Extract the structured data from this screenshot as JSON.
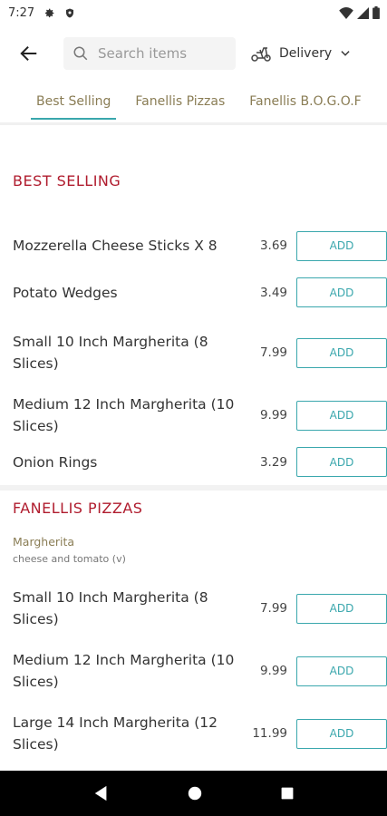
{
  "status": {
    "time": "7:27"
  },
  "search": {
    "placeholder": "Search items"
  },
  "delivery": {
    "label": "Delivery"
  },
  "tabs": [
    {
      "label": "Best Selling"
    },
    {
      "label": "Fanellis Pizzas"
    },
    {
      "label": "Fanellis B.O.G.O.F"
    }
  ],
  "best_selling": {
    "title": "BEST SELLING",
    "items": [
      {
        "name": "Mozzerella Cheese Sticks X 8",
        "price": "3.69",
        "add": "ADD"
      },
      {
        "name": "Potato Wedges",
        "price": "3.49",
        "add": "ADD"
      },
      {
        "name": "Small 10 Inch Margherita (8 Slices)",
        "price": "7.99",
        "add": "ADD"
      },
      {
        "name": "Medium 12 Inch Margherita (10 Slices)",
        "price": "9.99",
        "add": "ADD"
      },
      {
        "name": "Onion Rings",
        "price": "3.29",
        "add": "ADD"
      }
    ]
  },
  "fanellis_pizzas": {
    "title": "FANELLIS PIZZAS",
    "subtitle": "Margherita",
    "description": "cheese and tomato (v)",
    "items": [
      {
        "name": "Small 10 Inch Margherita (8 Slices)",
        "price": "7.99",
        "add": "ADD"
      },
      {
        "name": "Medium 12 Inch Margherita (10 Slices)",
        "price": "9.99",
        "add": "ADD"
      },
      {
        "name": "Large 14 Inch Margherita (12 Slices)",
        "price": "11.99",
        "add": "ADD"
      }
    ]
  }
}
